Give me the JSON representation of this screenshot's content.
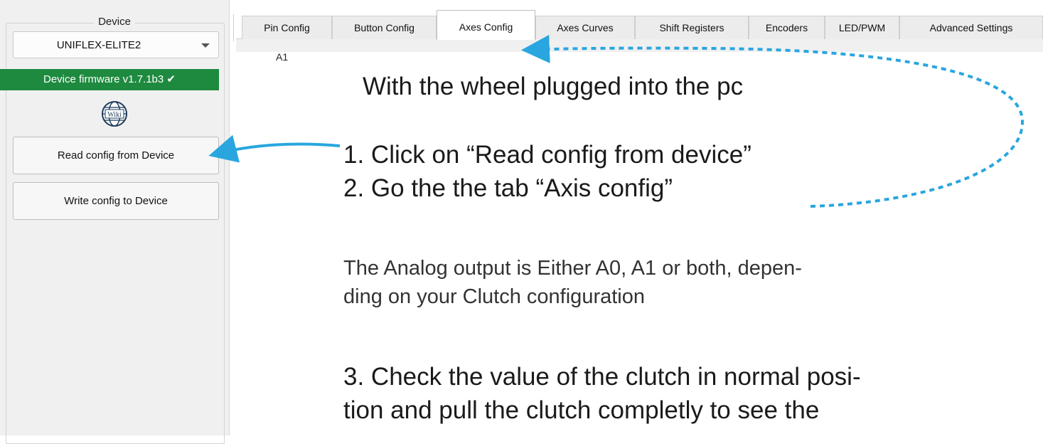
{
  "device_panel": {
    "group_title": "Device",
    "selected_device": "UNIFLEX-ELITE2",
    "firmware_status": "Device firmware v1.7.1b3 ✔",
    "wiki_icon_label": "Wiki",
    "read_button": "Read config from Device",
    "write_button": "Write config to Device"
  },
  "tabs": [
    {
      "label": "Pin Config"
    },
    {
      "label": "Button Config"
    },
    {
      "label": "Axes Config",
      "active": true
    },
    {
      "label": "Axes Curves"
    },
    {
      "label": "Shift Registers"
    },
    {
      "label": "Encoders"
    },
    {
      "label": "LED/PWM"
    },
    {
      "label": "Advanced Settings"
    }
  ],
  "tab_content_fragment": "A1",
  "instructions": {
    "intro": "With the wheel plugged into the pc",
    "step1": "1. Click on “Read config from device”",
    "step2": "2. Go the the tab “Axis config”",
    "note_line1": "The Analog output is Either A0, A1 or both, depen-",
    "note_line2": "ding on your Clutch configuration",
    "step3_line1": "3. Check the value of the clutch in normal posi-",
    "step3_line2": "tion and pull the clutch completly to see the"
  },
  "colors": {
    "firmware_ok": "#1e8a3f",
    "annotation_arrow": "#29a6df"
  }
}
